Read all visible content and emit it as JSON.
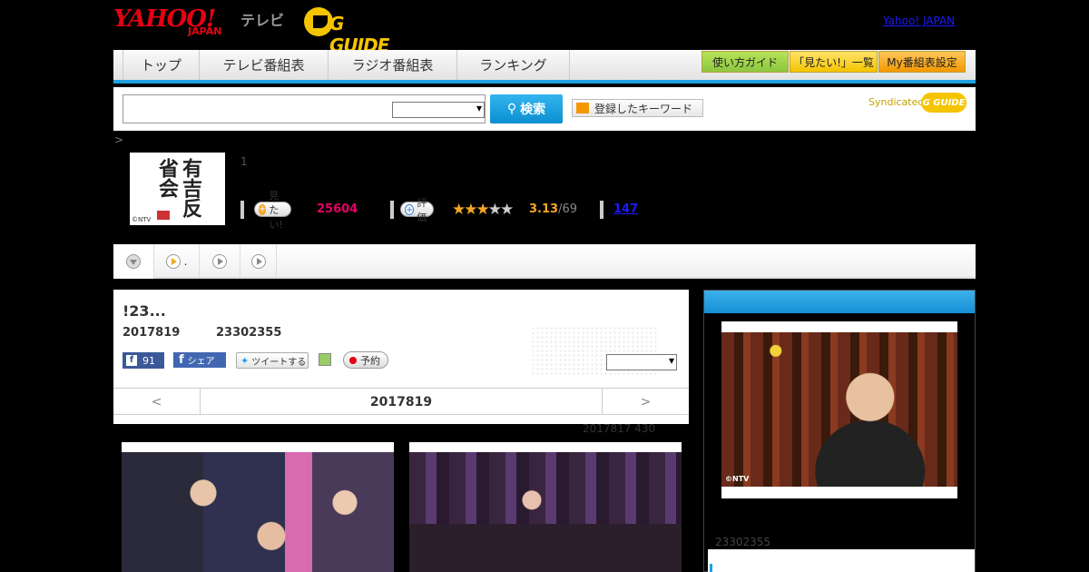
{
  "header": {
    "yahoo_logo": "YAHOO!",
    "yahoo_sub": "JAPAN",
    "tv_label": "テレビ",
    "gguide_logo": "G GUIDE",
    "yahoo_japan_link": "Yahoo! JAPAN"
  },
  "nav": {
    "tabs": [
      "トップ",
      "テレビ番組表",
      "ラジオ番組表",
      "ランキング"
    ],
    "guide_btn": "使い方ガイド",
    "watchlist_btn": "「見たい!」一覧",
    "my_btn": "My番組表設定"
  },
  "search": {
    "button": "検索",
    "keywords_btn": "登録したキーワード",
    "syndicated": "Syndicated",
    "syndicated_logo": "G GUIDE"
  },
  "breadcrumb": ">",
  "program": {
    "thumb_calligraphy": "有吉反省会",
    "thumb_credit": "©NTV",
    "episode_num": "1",
    "want_label": "見たい!",
    "want_count": "25604",
    "rate_label": "評価",
    "rating": "3.13",
    "rating_count": "/69",
    "review_count": "147"
  },
  "subtabs": {
    "tab2_label": "."
  },
  "episode": {
    "title": "!23...",
    "date": "2017819",
    "time": "23302355",
    "fb_like_count": "91",
    "fb_share": "シェア",
    "tweet": "ツイートする",
    "reserve": "予約",
    "pager_prev": "<",
    "pager_date": "2017819",
    "pager_next": ">"
  },
  "updated": "2017817  430",
  "sidebar": {
    "photo_credit": "©NTV",
    "time": "23302355"
  },
  "colors": {
    "accent_blue": "#1da1e0",
    "yahoo_red": "#e60012",
    "gguide_yellow": "#f5c400",
    "want_pink": "#e60065",
    "star_orange": "#f5a623"
  }
}
